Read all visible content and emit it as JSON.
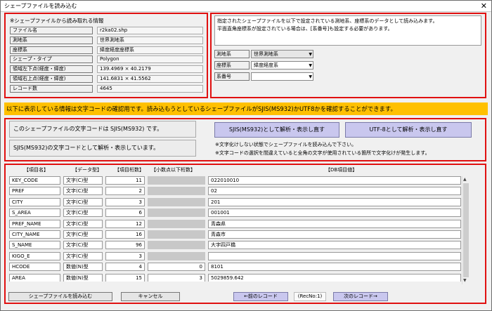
{
  "window": {
    "title": "シェープファイルを読み込む",
    "close_glyph": "✕"
  },
  "file_info": {
    "caption": "※シェープファイルから読み取れる情報",
    "rows": [
      {
        "label": "ファイル名",
        "value": "r2ka02.shp"
      },
      {
        "label": "測地系",
        "value": "世界測地系"
      },
      {
        "label": "座標系",
        "value": "緯度経度座標系"
      },
      {
        "label": "シェープ・タイプ",
        "value": "Polygon"
      },
      {
        "label": "領域左下点(経度・緯度)",
        "value": "139.4969 × 40.2179"
      },
      {
        "label": "領域右上点(経度・緯度)",
        "value": "141.6831 × 41.5562"
      },
      {
        "label": "レコード数",
        "value": "4645"
      }
    ]
  },
  "settings": {
    "description": [
      "指定されたシェープファイルを以下で設定されている測地系、座標系のデータとして読み込みます。",
      "平面直角座標系が設定されている場合は、[系番号]も設定する必要があります。"
    ],
    "fields": [
      {
        "label": "測地系",
        "value": "世界測地系"
      },
      {
        "label": "座標系",
        "value": "緯度経度系"
      },
      {
        "label": "系番号",
        "value": ""
      }
    ]
  },
  "warning_text": "以下に表示している情報は文字コードの確認用です。読み込もうとしているシェープファイルがSJIS(MS932)かUTF8かを確認することができます。",
  "encoding": {
    "detected_text": "このシェープファイルの文字コードは SJIS(MS932) です。",
    "displaying_text": "SJIS(MS932)の文字コードとして解析・表示しています。",
    "sjis_button": "SJIS(MS932)として解析・表示し直す",
    "utf8_button": "UTF-8として解析・表示し直す",
    "notes": [
      "※文字化けしない状態でシェープファイルを読み込んで下さい。",
      "※文字コードの選択を間違えていると全角の文字が使用されている箇所で文字化けが発生します。"
    ]
  },
  "table": {
    "headers": [
      "【項目名】",
      "【データ型】",
      "【項目桁数】",
      "【小数点以下桁数】",
      "【DB項目値】"
    ],
    "rows": [
      {
        "name": "KEY_CODE",
        "type": "文字(C)型",
        "len": "11",
        "dec": "",
        "value": "022010010"
      },
      {
        "name": "PREF",
        "type": "文字(C)型",
        "len": "2",
        "dec": "",
        "value": "02"
      },
      {
        "name": "CITY",
        "type": "文字(C)型",
        "len": "3",
        "dec": "",
        "value": "201"
      },
      {
        "name": "S_AREA",
        "type": "文字(C)型",
        "len": "6",
        "dec": "",
        "value": "001001"
      },
      {
        "name": "PREF_NAME",
        "type": "文字(C)型",
        "len": "12",
        "dec": "",
        "value": "青森県"
      },
      {
        "name": "CITY_NAME",
        "type": "文字(C)型",
        "len": "16",
        "dec": "",
        "value": "青森市"
      },
      {
        "name": "S_NAME",
        "type": "文字(C)型",
        "len": "96",
        "dec": "",
        "value": "大字四戸橋"
      },
      {
        "name": "KIGO_E",
        "type": "文字(C)型",
        "len": "3",
        "dec": "",
        "value": ""
      },
      {
        "name": "HCODE",
        "type": "数値(N)型",
        "len": "4",
        "dec": "0",
        "value": "8101"
      },
      {
        "name": "AREA",
        "type": "数値(N)型",
        "len": "15",
        "dec": "3",
        "value": "5029859.642"
      }
    ]
  },
  "footer": {
    "load_button": "シェープファイルを読み込む",
    "cancel_button": "キャンセル",
    "prev_button": "←前のレコード",
    "rec_no": "(RecNo:1)",
    "next_button": "次のレコード→"
  },
  "colors": {
    "highlight_border": "#e01010",
    "warning_bg": "#ffc000",
    "action_button_bg": "#c9c7ee"
  }
}
